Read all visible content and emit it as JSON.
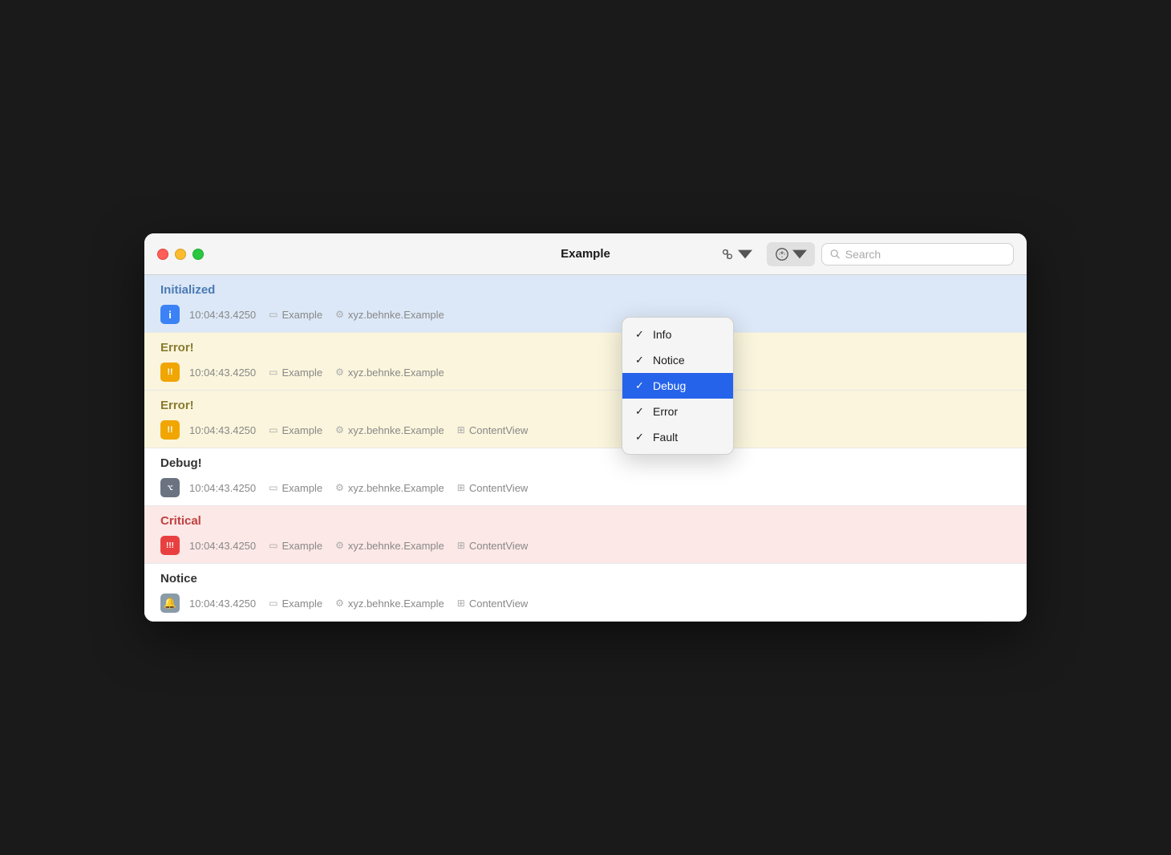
{
  "window": {
    "title": "Example"
  },
  "toolbar": {
    "search_placeholder": "Search",
    "filter_button_label": "Filter",
    "level_button_label": "Level"
  },
  "dropdown": {
    "items": [
      {
        "label": "Info",
        "checked": true,
        "selected": false
      },
      {
        "label": "Notice",
        "checked": true,
        "selected": false
      },
      {
        "label": "Debug",
        "checked": true,
        "selected": true
      },
      {
        "label": "Error",
        "checked": true,
        "selected": false
      },
      {
        "label": "Fault",
        "checked": true,
        "selected": false
      }
    ]
  },
  "logs": [
    {
      "section_title": "Initialized",
      "theme": "initialized",
      "badge_type": "info",
      "badge_text": "i",
      "timestamp": "10:04:43.4250",
      "process": "Example",
      "subsystem": "xyz.behnke.Example",
      "category": null
    },
    {
      "section_title": "Error!",
      "theme": "error",
      "badge_type": "error",
      "badge_text": "!!",
      "timestamp": "10:04:43.4250",
      "process": "Example",
      "subsystem": "xyz.behnke.Example",
      "category": null
    },
    {
      "section_title": "Error!",
      "theme": "error",
      "badge_type": "error",
      "badge_text": "!!",
      "timestamp": "10:04:43.4250",
      "process": "Example",
      "subsystem": "xyz.behnke.Example",
      "category": "ContentView"
    },
    {
      "section_title": "Debug!",
      "theme": "debug-section",
      "badge_type": "debug",
      "badge_text": "⌥",
      "timestamp": "10:04:43.4250",
      "process": "Example",
      "subsystem": "xyz.behnke.Example",
      "category": "ContentView"
    },
    {
      "section_title": "Critical",
      "theme": "critical",
      "badge_type": "critical",
      "badge_text": "!!!",
      "timestamp": "10:04:43.4250",
      "process": "Example",
      "subsystem": "xyz.behnke.Example",
      "category": "ContentView"
    },
    {
      "section_title": "Notice",
      "theme": "notice-section",
      "badge_type": "notice",
      "badge_text": "🔔",
      "timestamp": "10:04:43.4250",
      "process": "Example",
      "subsystem": "xyz.behnke.Example",
      "category": "ContentView"
    }
  ]
}
